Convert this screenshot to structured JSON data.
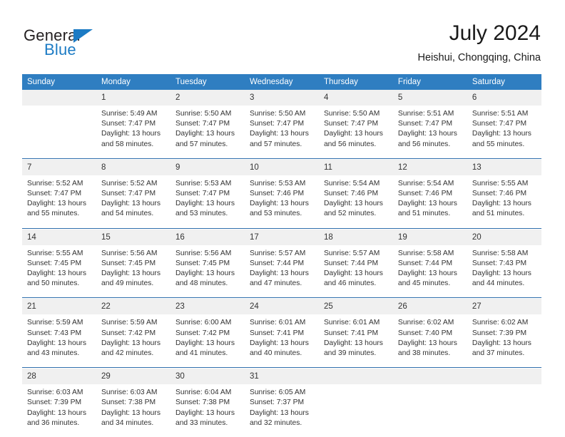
{
  "brand": {
    "name_part1": "General",
    "name_part2": "Blue",
    "accent_color": "#1c7bc4"
  },
  "header": {
    "title": "July 2024",
    "subtitle": "Heishui, Chongqing, China"
  },
  "theme": {
    "header_row_color": "#2f7ec1",
    "separator_color": "#2f6fad",
    "daynum_band_color": "#f0f0f0"
  },
  "weekday_headers": [
    "Sunday",
    "Monday",
    "Tuesday",
    "Wednesday",
    "Thursday",
    "Friday",
    "Saturday"
  ],
  "weeks": [
    {
      "days": [
        {
          "number": "",
          "sunrise": "",
          "sunset": "",
          "daylight1": "",
          "daylight2": ""
        },
        {
          "number": "1",
          "sunrise": "Sunrise: 5:49 AM",
          "sunset": "Sunset: 7:47 PM",
          "daylight1": "Daylight: 13 hours",
          "daylight2": "and 58 minutes."
        },
        {
          "number": "2",
          "sunrise": "Sunrise: 5:50 AM",
          "sunset": "Sunset: 7:47 PM",
          "daylight1": "Daylight: 13 hours",
          "daylight2": "and 57 minutes."
        },
        {
          "number": "3",
          "sunrise": "Sunrise: 5:50 AM",
          "sunset": "Sunset: 7:47 PM",
          "daylight1": "Daylight: 13 hours",
          "daylight2": "and 57 minutes."
        },
        {
          "number": "4",
          "sunrise": "Sunrise: 5:50 AM",
          "sunset": "Sunset: 7:47 PM",
          "daylight1": "Daylight: 13 hours",
          "daylight2": "and 56 minutes."
        },
        {
          "number": "5",
          "sunrise": "Sunrise: 5:51 AM",
          "sunset": "Sunset: 7:47 PM",
          "daylight1": "Daylight: 13 hours",
          "daylight2": "and 56 minutes."
        },
        {
          "number": "6",
          "sunrise": "Sunrise: 5:51 AM",
          "sunset": "Sunset: 7:47 PM",
          "daylight1": "Daylight: 13 hours",
          "daylight2": "and 55 minutes."
        }
      ]
    },
    {
      "days": [
        {
          "number": "7",
          "sunrise": "Sunrise: 5:52 AM",
          "sunset": "Sunset: 7:47 PM",
          "daylight1": "Daylight: 13 hours",
          "daylight2": "and 55 minutes."
        },
        {
          "number": "8",
          "sunrise": "Sunrise: 5:52 AM",
          "sunset": "Sunset: 7:47 PM",
          "daylight1": "Daylight: 13 hours",
          "daylight2": "and 54 minutes."
        },
        {
          "number": "9",
          "sunrise": "Sunrise: 5:53 AM",
          "sunset": "Sunset: 7:47 PM",
          "daylight1": "Daylight: 13 hours",
          "daylight2": "and 53 minutes."
        },
        {
          "number": "10",
          "sunrise": "Sunrise: 5:53 AM",
          "sunset": "Sunset: 7:46 PM",
          "daylight1": "Daylight: 13 hours",
          "daylight2": "and 53 minutes."
        },
        {
          "number": "11",
          "sunrise": "Sunrise: 5:54 AM",
          "sunset": "Sunset: 7:46 PM",
          "daylight1": "Daylight: 13 hours",
          "daylight2": "and 52 minutes."
        },
        {
          "number": "12",
          "sunrise": "Sunrise: 5:54 AM",
          "sunset": "Sunset: 7:46 PM",
          "daylight1": "Daylight: 13 hours",
          "daylight2": "and 51 minutes."
        },
        {
          "number": "13",
          "sunrise": "Sunrise: 5:55 AM",
          "sunset": "Sunset: 7:46 PM",
          "daylight1": "Daylight: 13 hours",
          "daylight2": "and 51 minutes."
        }
      ]
    },
    {
      "days": [
        {
          "number": "14",
          "sunrise": "Sunrise: 5:55 AM",
          "sunset": "Sunset: 7:45 PM",
          "daylight1": "Daylight: 13 hours",
          "daylight2": "and 50 minutes."
        },
        {
          "number": "15",
          "sunrise": "Sunrise: 5:56 AM",
          "sunset": "Sunset: 7:45 PM",
          "daylight1": "Daylight: 13 hours",
          "daylight2": "and 49 minutes."
        },
        {
          "number": "16",
          "sunrise": "Sunrise: 5:56 AM",
          "sunset": "Sunset: 7:45 PM",
          "daylight1": "Daylight: 13 hours",
          "daylight2": "and 48 minutes."
        },
        {
          "number": "17",
          "sunrise": "Sunrise: 5:57 AM",
          "sunset": "Sunset: 7:44 PM",
          "daylight1": "Daylight: 13 hours",
          "daylight2": "and 47 minutes."
        },
        {
          "number": "18",
          "sunrise": "Sunrise: 5:57 AM",
          "sunset": "Sunset: 7:44 PM",
          "daylight1": "Daylight: 13 hours",
          "daylight2": "and 46 minutes."
        },
        {
          "number": "19",
          "sunrise": "Sunrise: 5:58 AM",
          "sunset": "Sunset: 7:44 PM",
          "daylight1": "Daylight: 13 hours",
          "daylight2": "and 45 minutes."
        },
        {
          "number": "20",
          "sunrise": "Sunrise: 5:58 AM",
          "sunset": "Sunset: 7:43 PM",
          "daylight1": "Daylight: 13 hours",
          "daylight2": "and 44 minutes."
        }
      ]
    },
    {
      "days": [
        {
          "number": "21",
          "sunrise": "Sunrise: 5:59 AM",
          "sunset": "Sunset: 7:43 PM",
          "daylight1": "Daylight: 13 hours",
          "daylight2": "and 43 minutes."
        },
        {
          "number": "22",
          "sunrise": "Sunrise: 5:59 AM",
          "sunset": "Sunset: 7:42 PM",
          "daylight1": "Daylight: 13 hours",
          "daylight2": "and 42 minutes."
        },
        {
          "number": "23",
          "sunrise": "Sunrise: 6:00 AM",
          "sunset": "Sunset: 7:42 PM",
          "daylight1": "Daylight: 13 hours",
          "daylight2": "and 41 minutes."
        },
        {
          "number": "24",
          "sunrise": "Sunrise: 6:01 AM",
          "sunset": "Sunset: 7:41 PM",
          "daylight1": "Daylight: 13 hours",
          "daylight2": "and 40 minutes."
        },
        {
          "number": "25",
          "sunrise": "Sunrise: 6:01 AM",
          "sunset": "Sunset: 7:41 PM",
          "daylight1": "Daylight: 13 hours",
          "daylight2": "and 39 minutes."
        },
        {
          "number": "26",
          "sunrise": "Sunrise: 6:02 AM",
          "sunset": "Sunset: 7:40 PM",
          "daylight1": "Daylight: 13 hours",
          "daylight2": "and 38 minutes."
        },
        {
          "number": "27",
          "sunrise": "Sunrise: 6:02 AM",
          "sunset": "Sunset: 7:39 PM",
          "daylight1": "Daylight: 13 hours",
          "daylight2": "and 37 minutes."
        }
      ]
    },
    {
      "days": [
        {
          "number": "28",
          "sunrise": "Sunrise: 6:03 AM",
          "sunset": "Sunset: 7:39 PM",
          "daylight1": "Daylight: 13 hours",
          "daylight2": "and 36 minutes."
        },
        {
          "number": "29",
          "sunrise": "Sunrise: 6:03 AM",
          "sunset": "Sunset: 7:38 PM",
          "daylight1": "Daylight: 13 hours",
          "daylight2": "and 34 minutes."
        },
        {
          "number": "30",
          "sunrise": "Sunrise: 6:04 AM",
          "sunset": "Sunset: 7:38 PM",
          "daylight1": "Daylight: 13 hours",
          "daylight2": "and 33 minutes."
        },
        {
          "number": "31",
          "sunrise": "Sunrise: 6:05 AM",
          "sunset": "Sunset: 7:37 PM",
          "daylight1": "Daylight: 13 hours",
          "daylight2": "and 32 minutes."
        },
        {
          "number": "",
          "sunrise": "",
          "sunset": "",
          "daylight1": "",
          "daylight2": ""
        },
        {
          "number": "",
          "sunrise": "",
          "sunset": "",
          "daylight1": "",
          "daylight2": ""
        },
        {
          "number": "",
          "sunrise": "",
          "sunset": "",
          "daylight1": "",
          "daylight2": ""
        }
      ]
    }
  ]
}
